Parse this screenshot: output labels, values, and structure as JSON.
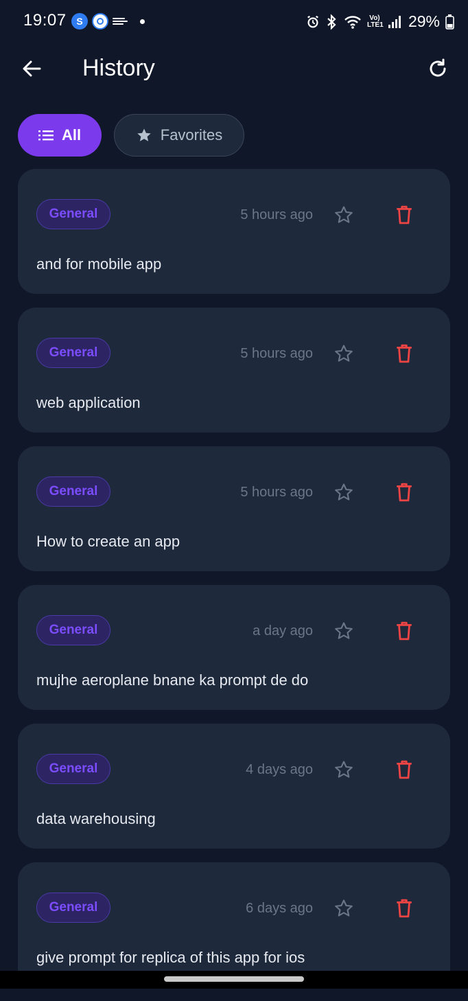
{
  "status_bar": {
    "time": "19:07",
    "app_badge_s": "S",
    "app_badge_ring": "●",
    "battery": "29%",
    "lte": "Vo) LTE1"
  },
  "header": {
    "title": "History"
  },
  "filters": {
    "all_label": "All",
    "favorites_label": "Favorites"
  },
  "items": [
    {
      "tag": "General",
      "time": "5 hours ago",
      "text": "and for mobile app"
    },
    {
      "tag": "General",
      "time": "5 hours ago",
      "text": "web application"
    },
    {
      "tag": "General",
      "time": "5 hours ago",
      "text": "How to create an app"
    },
    {
      "tag": "General",
      "time": "a day ago",
      "text": "mujhe aeroplane bnane ka prompt de do"
    },
    {
      "tag": "General",
      "time": "4 days ago",
      "text": "data warehousing"
    },
    {
      "tag": "General",
      "time": "6 days ago",
      "text": "give prompt for replica of this app for ios"
    }
  ],
  "colors": {
    "background": "#0f1729",
    "card": "#1e293b",
    "accent": "#7c3aed",
    "tag_text": "#7c4dff",
    "delete": "#ef4444"
  },
  "icons": {
    "back": "arrow-left-icon",
    "refresh": "refresh-icon",
    "all": "list-icon",
    "favorites": "star-icon",
    "favorite_toggle": "star-outline-icon",
    "delete": "trash-icon"
  }
}
